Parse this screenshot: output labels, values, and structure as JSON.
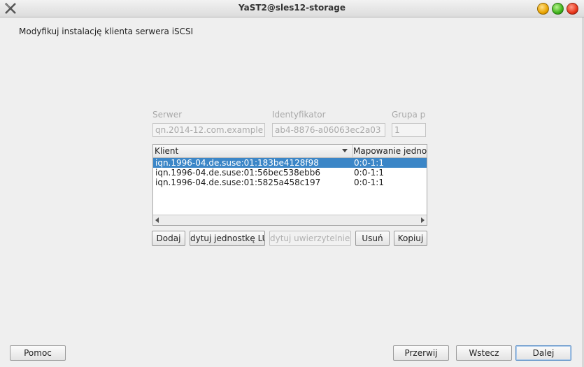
{
  "window": {
    "title": "YaST2@sles12-storage"
  },
  "page": {
    "heading": "Modyfikuj instalację klienta serwera iSCSI"
  },
  "fields": {
    "server_label": "Serwer",
    "server_value": "qn.2014-12.com.example",
    "identifier_label": "Identyfikator",
    "identifier_value": "ab4-8876-a06063ec2a03",
    "group_label": "Grupa p",
    "group_value": "1"
  },
  "table": {
    "columns": [
      "Klient",
      "Mapowanie jedno"
    ],
    "rows": [
      {
        "client": "iqn.1996-04.de.suse:01:183be4128f98",
        "mapping": "0:0-1:1",
        "selected": true
      },
      {
        "client": "iqn.1996-04.de.suse:01:56bec538ebb6",
        "mapping": "0:0-1:1",
        "selected": false
      },
      {
        "client": "iqn.1996-04.de.suse:01:5825a458c197",
        "mapping": "0:0-1:1",
        "selected": false
      }
    ]
  },
  "actions": {
    "add": "Dodaj",
    "edit_lun": "dytuj jednostkę LU",
    "edit_auth": "dytuj uwierzytelnien",
    "delete": "Usuń",
    "copy": "Kopiuj"
  },
  "footer": {
    "help": "Pomoc",
    "abort": "Przerwij",
    "back": "Wstecz",
    "next": "Dalej"
  },
  "colors": {
    "selection": "#3b86c7",
    "background": "#efefef"
  }
}
